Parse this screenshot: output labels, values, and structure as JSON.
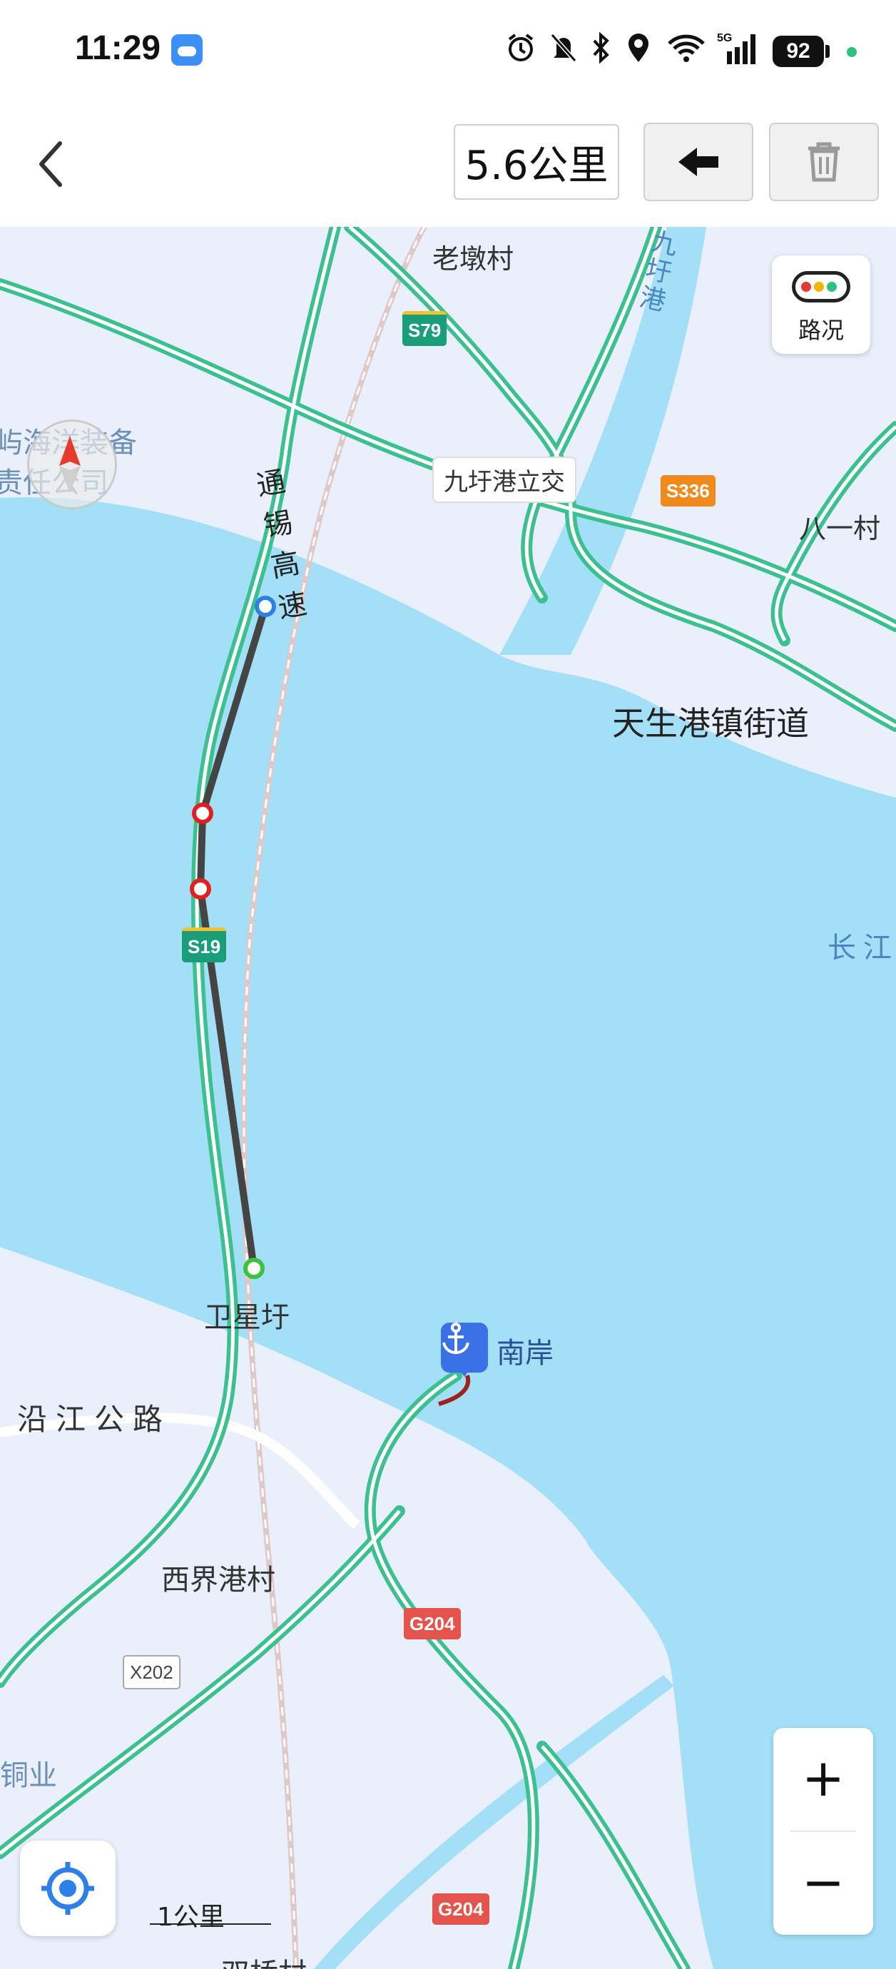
{
  "status_bar": {
    "time": "11:29",
    "battery": "92",
    "network": "5G",
    "icons": [
      "weather-icon",
      "alarm-icon",
      "mute-icon",
      "bluetooth-icon",
      "location-icon",
      "wifi-icon",
      "signal-icon",
      "battery-icon"
    ]
  },
  "toolbar": {
    "distance": "5.6公里",
    "back_icon": "chevron-left-icon",
    "undo_icon": "arrow-left-icon",
    "delete_icon": "trash-icon"
  },
  "map": {
    "traffic_label": "路况",
    "scale_label": "1公里",
    "labels": {
      "laodun": "老墩村",
      "jiuyugang_river": "九圩港",
      "jiuyu_interchange": "九圩港立交",
      "bayi": "八一村",
      "tianshenggang": "天生港镇街道",
      "changjiang": "长江",
      "company_line1": "屿海洋装备",
      "company_line2": "责任公司",
      "tongxi_highway": "通锡高速",
      "weixingyu": "卫星圩",
      "nanan": "南岸",
      "yanjiang_road": "沿江公路",
      "xijiegang": "西界港村",
      "tongye": "铜业",
      "shuangqiao": "双桥村"
    },
    "shields": {
      "s79": "S79",
      "s336": "S336",
      "s19": "S19",
      "g204_a": "G204",
      "g204_b": "G204",
      "x202": "X202"
    },
    "colors": {
      "water": "#a3e0f7",
      "land": "#eaf0fb",
      "road": "#3cc08f",
      "measure_line": "#444444",
      "waypoint_red": "#e02020",
      "waypoint_blue": "#2f7fe8",
      "waypoint_green": "#3cc23c"
    }
  },
  "controls": {
    "zoom_in": "+",
    "zoom_out": "−",
    "locate_icon": "locate-icon",
    "compass_icon": "compass-icon",
    "port_icon": "anchor-icon"
  }
}
